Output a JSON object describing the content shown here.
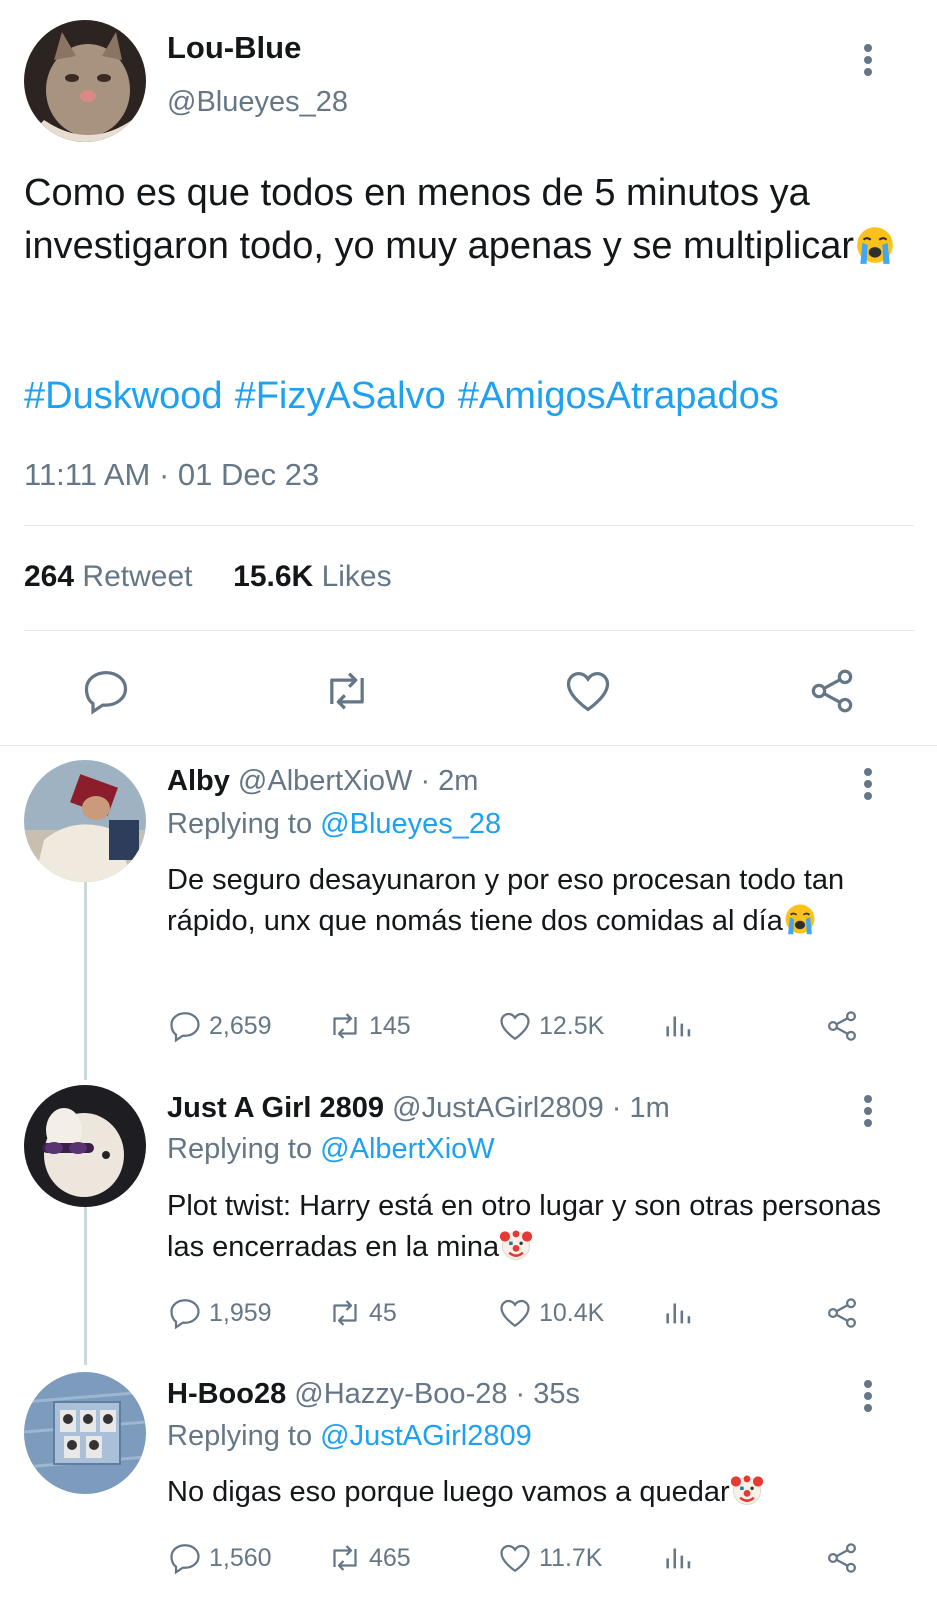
{
  "main_tweet": {
    "name": "Lou-Blue",
    "handle": "@Blueyes_28",
    "text": "Como es que todos en menos de 5 minutos ya investigaron todo, yo muy apenas y se multiplicar",
    "hashtags": [
      "#Duskwood",
      "#FizyASalvo",
      "#AmigosAtrapados"
    ],
    "timestamp": "11:11 AM · 01 Dec 23",
    "retweet_count": "264",
    "retweet_label": "Retweet",
    "likes_count": "15.6K",
    "likes_label": "Likes"
  },
  "replies": [
    {
      "name": "Alby",
      "handle": "@AlbertXioW",
      "time": "· 2m",
      "replying_label": "Replying to",
      "replying_to": "@Blueyes_28",
      "text": "De seguro desayunaron y por eso procesan todo tan rápido, unx que nomás tiene dos comidas al día",
      "replies": "2,659",
      "retweets": "145",
      "likes": "12.5K"
    },
    {
      "name": "Just A Girl 2809",
      "handle": "@JustAGirl2809",
      "time": "· 1m",
      "replying_label": "Replying to",
      "replying_to": "@AlbertXioW",
      "text": "Plot twist: Harry está en otro lugar y son otras personas las encerradas en la mina",
      "replies": "1,959",
      "retweets": "45",
      "likes": "10.4K"
    },
    {
      "name": "H-Boo28",
      "handle": "@Hazzy-Boo-28",
      "time": "· 35s",
      "replying_label": "Replying to",
      "replying_to": "@JustAGirl2809",
      "text": "No digas eso porque luego vamos a quedar",
      "replies": "1,560",
      "retweets": "465",
      "likes": "11.7K"
    }
  ],
  "icons": {
    "reply": "reply-icon",
    "retweet": "retweet-icon",
    "like": "heart-icon",
    "share": "share-icon",
    "analytics": "analytics-icon",
    "more": "more-icon",
    "crying": "loudly-crying-face-emoji",
    "clown": "clown-face-emoji"
  },
  "colors": {
    "accent": "#1da1f2",
    "muted": "#657786",
    "text": "#14171a",
    "divider": "#e1e8ed"
  }
}
